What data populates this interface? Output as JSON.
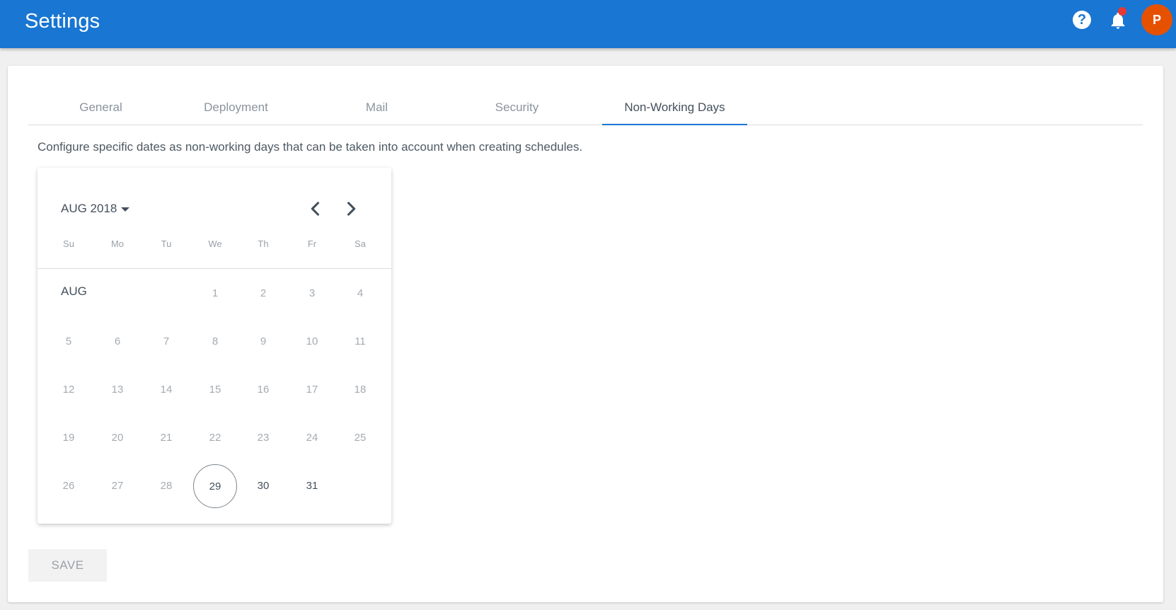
{
  "header": {
    "title": "Settings",
    "help_icon": "question-circle-icon",
    "notification_icon": "bell-icon",
    "avatar_initial": "P",
    "avatar_color": "#e65100",
    "accent_color": "#1976d2"
  },
  "tabs": [
    {
      "label": "General",
      "active": false
    },
    {
      "label": "Deployment",
      "active": false
    },
    {
      "label": "Mail",
      "active": false
    },
    {
      "label": "Security",
      "active": false
    },
    {
      "label": "Non-Working Days",
      "active": true
    }
  ],
  "description": "Configure specific dates as non-working days that can be taken into account when creating schedules.",
  "calendar": {
    "month_year": "AUG 2018",
    "month_label": "AUG",
    "prev_icon": "chevron-left-icon",
    "next_icon": "chevron-right-icon",
    "weekdays": [
      "Su",
      "Mo",
      "Tu",
      "We",
      "Th",
      "Fr",
      "Sa"
    ],
    "first_weekday_index": 3,
    "days_in_month": 31,
    "today": 29
  },
  "save_label": "SAVE"
}
